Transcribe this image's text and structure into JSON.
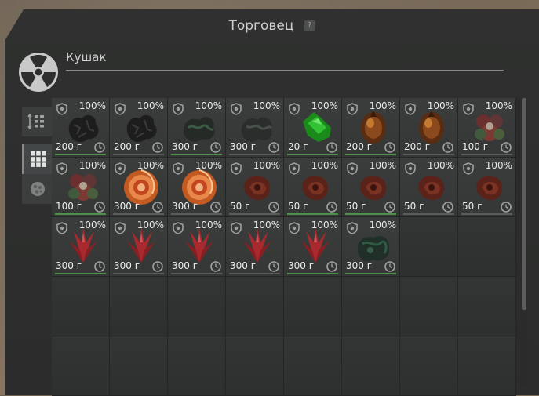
{
  "window": {
    "title": "Торговец",
    "help_label": "?"
  },
  "npc": {
    "name": "Кушак",
    "icon": "radiation-icon"
  },
  "sidebar": {
    "buttons": [
      {
        "icon": "sort-icon",
        "active": false
      },
      {
        "icon": "grid-view-icon",
        "active": true
      },
      {
        "icon": "artifact-filter-icon",
        "active": false
      }
    ]
  },
  "colors": {
    "accent_green": "#4e8f4e",
    "text": "#eeeeee",
    "icon_gray": "#9fa1a0"
  },
  "inventory": {
    "items": [
      {
        "pct": "100%",
        "price": "200 г",
        "art": "dark",
        "green": true
      },
      {
        "pct": "100%",
        "price": "200 г",
        "art": "dark",
        "green": false
      },
      {
        "pct": "100%",
        "price": "300 г",
        "art": "darkgreen",
        "green": true
      },
      {
        "pct": "100%",
        "price": "300 г",
        "art": "gray",
        "green": false
      },
      {
        "pct": "100%",
        "price": "20 г",
        "art": "emerald",
        "green": true
      },
      {
        "pct": "100%",
        "price": "200 г",
        "art": "amber",
        "green": true
      },
      {
        "pct": "100%",
        "price": "200 г",
        "art": "amber",
        "green": false
      },
      {
        "pct": "100%",
        "price": "100 г",
        "art": "flower",
        "green": false
      },
      {
        "pct": "100%",
        "price": "100 г",
        "art": "flower",
        "green": true
      },
      {
        "pct": "100%",
        "price": "300 г",
        "art": "spiral",
        "green": false
      },
      {
        "pct": "100%",
        "price": "300 г",
        "art": "spiral",
        "green": false
      },
      {
        "pct": "100%",
        "price": "50 г",
        "art": "rust",
        "green": false
      },
      {
        "pct": "100%",
        "price": "50 г",
        "art": "rust",
        "green": true
      },
      {
        "pct": "100%",
        "price": "50 г",
        "art": "rust",
        "green": true
      },
      {
        "pct": "100%",
        "price": "50 г",
        "art": "rust",
        "green": false
      },
      {
        "pct": "100%",
        "price": "50 г",
        "art": "rust",
        "green": false
      },
      {
        "pct": "100%",
        "price": "300 г",
        "art": "crystal",
        "green": true
      },
      {
        "pct": "100%",
        "price": "300 г",
        "art": "crystal",
        "green": false
      },
      {
        "pct": "100%",
        "price": "300 г",
        "art": "crystal",
        "green": false
      },
      {
        "pct": "100%",
        "price": "300 г",
        "art": "crystal",
        "green": false
      },
      {
        "pct": "100%",
        "price": "300 г",
        "art": "crystal",
        "green": true
      },
      {
        "pct": "100%",
        "price": "300 г",
        "art": "moss",
        "green": true
      }
    ],
    "total_slots": 40
  }
}
